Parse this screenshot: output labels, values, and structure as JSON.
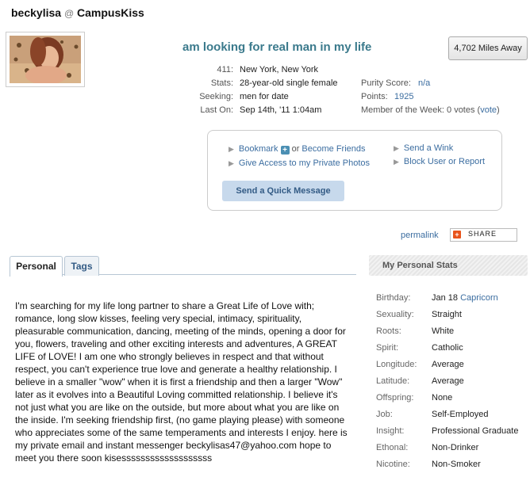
{
  "header": {
    "username": "beckylisa",
    "at": "@",
    "site": "CampusKiss"
  },
  "profile": {
    "headline": "am looking for real man in my life",
    "distance": "4,702 Miles Away",
    "info": [
      {
        "label": "411:",
        "value": "New York, New York"
      },
      {
        "label": "Stats:",
        "value": "28-year-old single female"
      },
      {
        "label": "Seeking:",
        "value": "men for date"
      },
      {
        "label": "Last On:",
        "value": "Sep 14th, '11 1:04am"
      }
    ],
    "purity_label": "Purity Score:",
    "purity_value": "n/a",
    "points_label": "Points:",
    "points_value": "1925",
    "motw_label": "Member of the Week:",
    "motw_votes": "0 votes",
    "motw_paren_open": "(",
    "motw_vote_link": "vote",
    "motw_paren_close": ")"
  },
  "actions": {
    "bookmark": "Bookmark",
    "plus": "+",
    "or_text": "or",
    "become_friends": "Become Friends",
    "give_access": "Give Access to my Private Photos",
    "send_wink": "Send a Wink",
    "block": "Block User or Report",
    "quick_message": "Send a Quick Message"
  },
  "share": {
    "permalink": "permalink",
    "share_label": "SHARE",
    "share_icon": "+"
  },
  "tabs": [
    {
      "label": "Personal"
    },
    {
      "label": "Tags"
    }
  ],
  "bio": "I'm searching for my life long partner to share a Great Life of Love with; romance, long slow kisses, feeling very special, intimacy, spirituality, pleasurable communication, dancing, meeting of the minds, opening a door for you, flowers, traveling and other exciting interests and adventures, A GREAT LIFE of LOVE! I am one who strongly believes in respect and that without respect, you can't experience true love and generate a healthy relationship. I believe in a smaller \"wow\" when it is first a friendship and then a larger \"Wow\" later as it evolves into a Beautiful Loving committed relationship. I believe it's not just what you are like on the outside, but more about what you are like on the inside. I'm seeking friendship first, (no game playing please) with someone who appreciates some of the same temperaments and interests I enjoy. here is my private email and instant messenger beckylisas47@yahoo.com hope to meet you there soon kisesssssssssssssssssss",
  "stats": {
    "header": "My Personal Stats",
    "items": [
      {
        "label": "Birthday:",
        "value": "Jan 18",
        "extra": "Capricorn"
      },
      {
        "label": "Sexuality:",
        "value": "Straight"
      },
      {
        "label": "Roots:",
        "value": "White"
      },
      {
        "label": "Spirit:",
        "value": "Catholic"
      },
      {
        "label": "Longitude:",
        "value": "Average"
      },
      {
        "label": "Latitude:",
        "value": "Average"
      },
      {
        "label": "Offspring:",
        "value": "None"
      },
      {
        "label": "Job:",
        "value": "Self-Employed"
      },
      {
        "label": "Insight:",
        "value": "Professional Graduate"
      },
      {
        "label": "Ethonal:",
        "value": "Non-Drinker"
      },
      {
        "label": "Nicotine:",
        "value": "Non-Smoker"
      }
    ]
  },
  "colors": {
    "link": "#3b6da0",
    "headline": "#3b7a8c",
    "button_bg": "#c7d9ec"
  }
}
